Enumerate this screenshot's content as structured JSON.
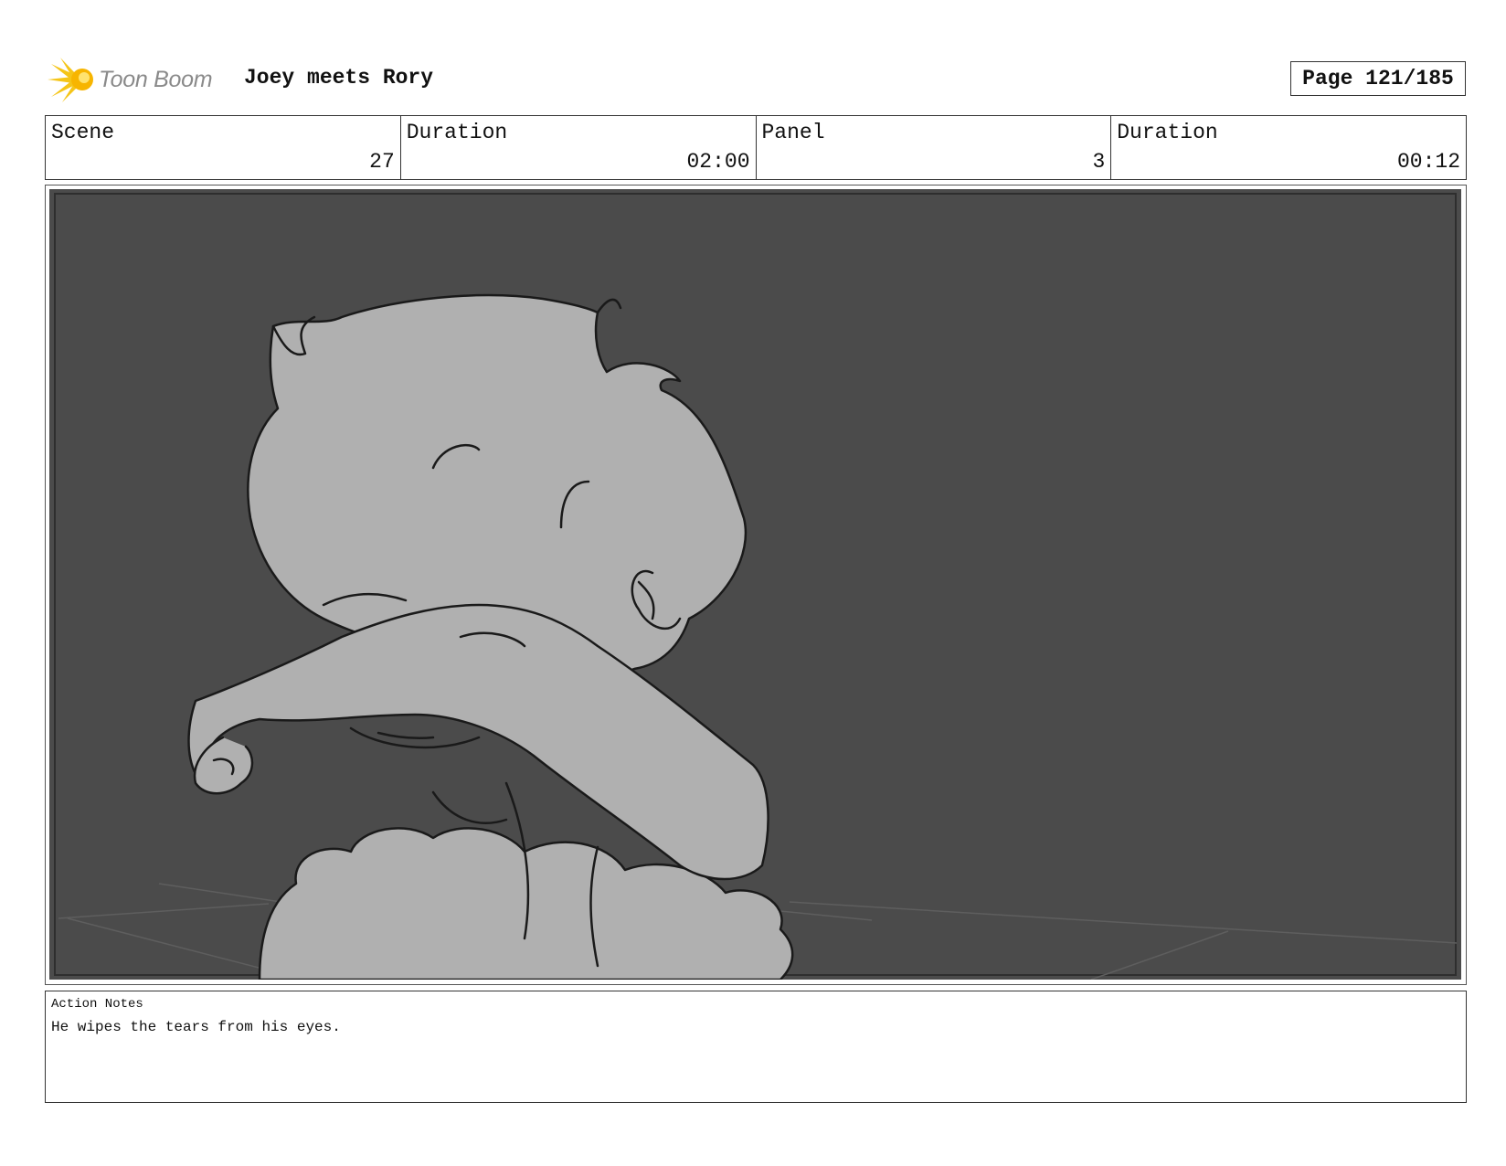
{
  "header": {
    "logo_text": "Toon Boom",
    "title": "Joey meets Rory",
    "page_label": "Page 121/185"
  },
  "info": [
    {
      "label": "Scene",
      "value": "27"
    },
    {
      "label": "Duration",
      "value": "02:00"
    },
    {
      "label": "Panel",
      "value": "3"
    },
    {
      "label": "Duration",
      "value": "00:12"
    }
  ],
  "notes": {
    "label": "Action Notes",
    "text": "He wipes the tears from his eyes."
  },
  "colors": {
    "background_dark": "#4b4b4b",
    "character_fill": "#b0b0b0",
    "line": "#1a1a1a",
    "logo_yellow": "#f5c518"
  }
}
